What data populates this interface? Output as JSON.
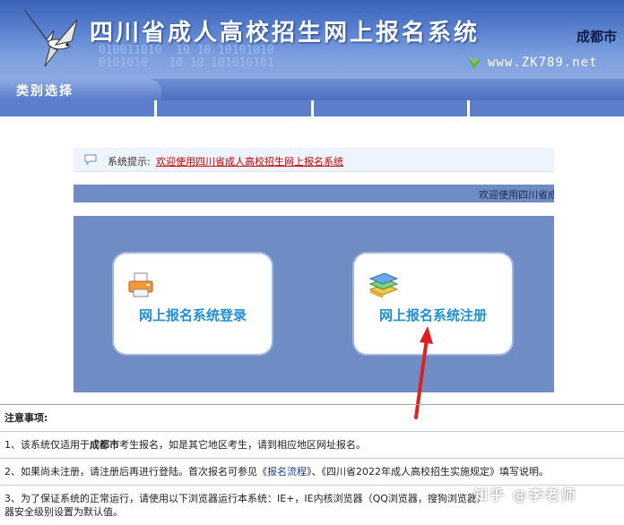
{
  "header": {
    "title": "四川省成人高校招生网上报名系统",
    "city": "成都市",
    "url": "www.ZK789.net",
    "binary": "010011010  10 10 10101010\n0101010   10 10 101010101"
  },
  "category": {
    "title": "类别选择"
  },
  "notice": {
    "label": "系统提示:",
    "text": "欢迎使用四川省成人高校招生网上报名系统"
  },
  "marquee": {
    "text": "欢迎使用四川省成"
  },
  "cards": {
    "login_label": "网上报名系统登录",
    "register_label": "网上报名系统注册"
  },
  "notes": {
    "heading": "注意事项:",
    "n1_a": "1、该系统仅适用于",
    "n1_b": "成都市",
    "n1_c": "考生报名，如是其它地区考生，请到相应地区网址报名。",
    "n2_a": "2、如果尚未注册，请注册后再进行登陆。首次报名可参见《",
    "n2_link": "报名流程",
    "n2_b": "》、《四川省2022年成人高校招生实施规定》填写说明。",
    "n3_a": "3、为了保证系统的正常运行，请使用以下浏览器运行本系统：IE+，IE内核浏览器（QQ浏览器，搜狗浏览器）",
    "n3_b": "器安全级别设置为默认值。"
  },
  "watermark": "知乎 @李老师",
  "colors": {
    "accent": "#1f8fd8",
    "panel": "#6f8cc4",
    "alert": "#cc0000"
  }
}
